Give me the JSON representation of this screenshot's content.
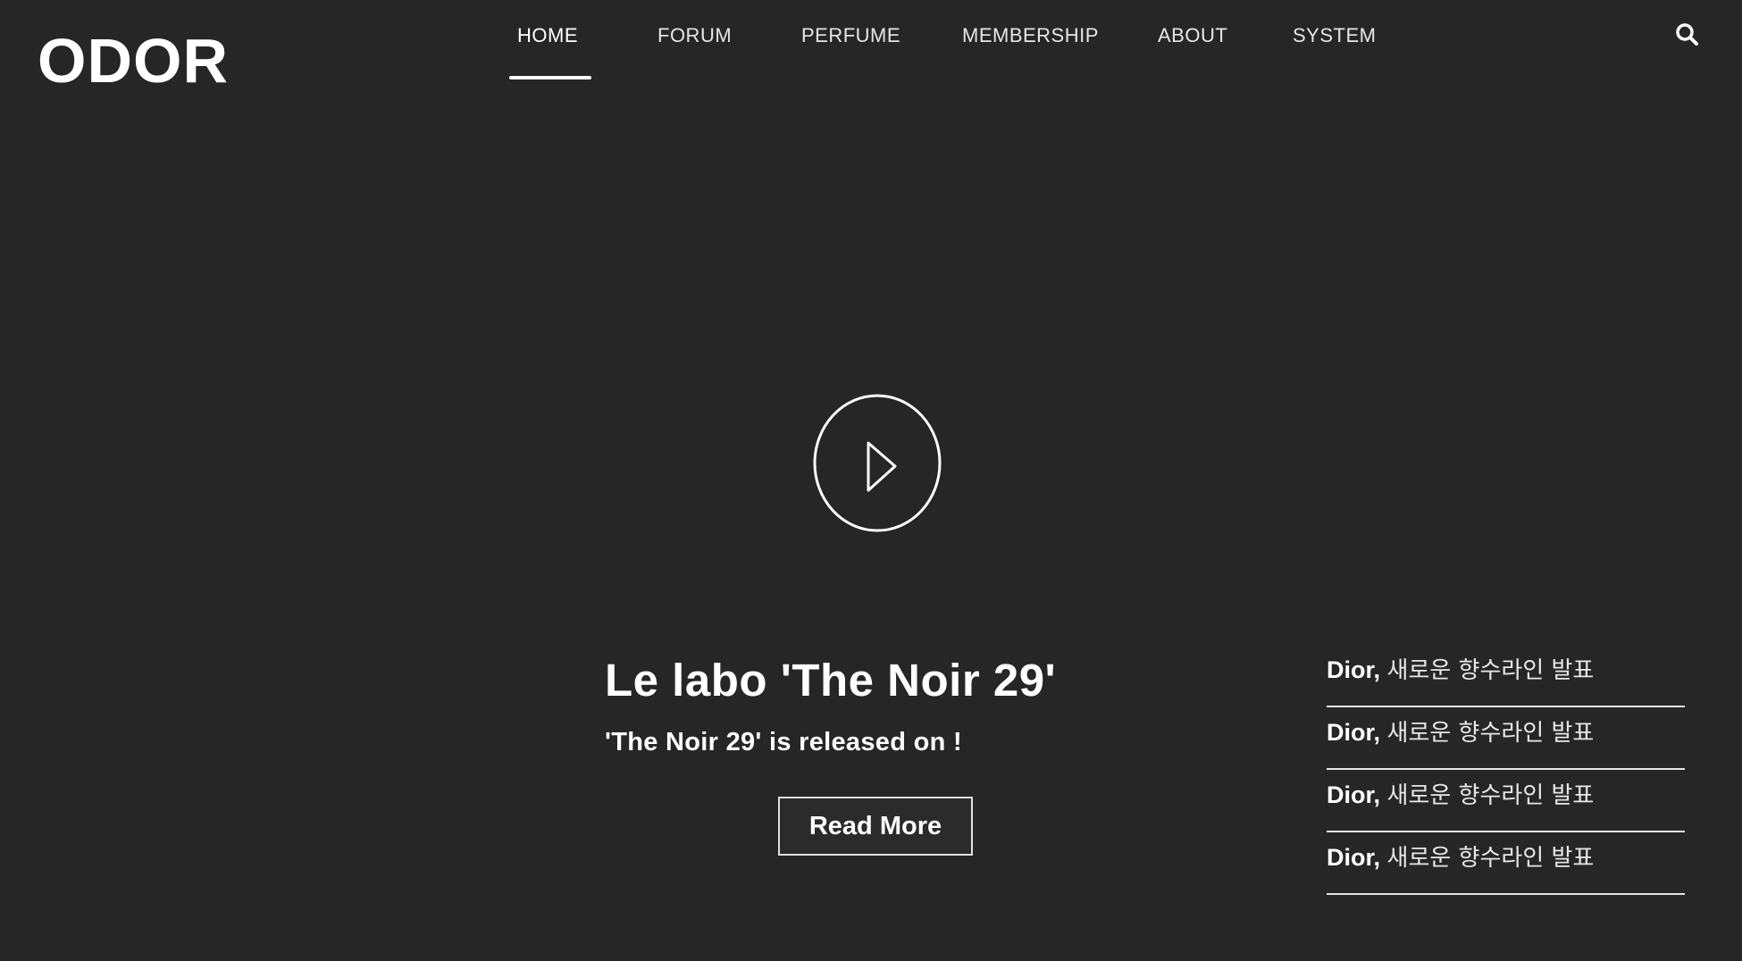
{
  "header": {
    "logo": "ODOR",
    "nav": [
      "HOME",
      "FORUM",
      "PERFUME",
      "MEMBERSHIP",
      "ABOUT",
      "SYSTEM"
    ],
    "active_nav": "HOME",
    "search_icon": "search-icon"
  },
  "hero": {
    "play_icon": "play-icon",
    "title": "Le labo 'The Noir 29'",
    "subtitle": "'The Noir 29' is released on !",
    "button_label": "Read More"
  },
  "news": [
    {
      "brand": "Dior,",
      "title": "새로운 향수라인 발표"
    },
    {
      "brand": "Dior,",
      "title": "새로운 향수라인 발표"
    },
    {
      "brand": "Dior,",
      "title": "새로운 향수라인 발표"
    },
    {
      "brand": "Dior,",
      "title": "새로운 향수라인 발표"
    }
  ],
  "colors": {
    "background": "#262626",
    "text": "#ffffff"
  }
}
